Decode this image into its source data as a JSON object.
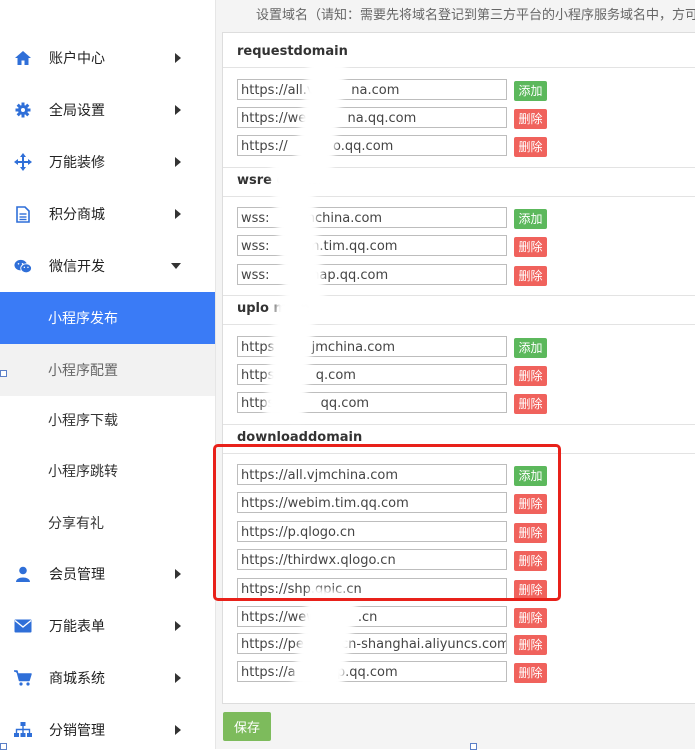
{
  "sidebar": {
    "brand": "",
    "items": [
      {
        "label": "账户中心",
        "icon": "home-icon",
        "arrow": "right"
      },
      {
        "label": "全局设置",
        "icon": "gear-icon",
        "arrow": "right"
      },
      {
        "label": "万能装修",
        "icon": "move-arrows-icon",
        "arrow": "right"
      },
      {
        "label": "积分商城",
        "icon": "document-icon",
        "arrow": "right"
      },
      {
        "label": "微信开发",
        "icon": "wechat-icon",
        "arrow": "down"
      },
      {
        "label": "会员管理",
        "icon": "user-icon",
        "arrow": "right"
      },
      {
        "label": "万能表单",
        "icon": "envelope-icon",
        "arrow": "right"
      },
      {
        "label": "商城系统",
        "icon": "cart-icon",
        "arrow": "right"
      },
      {
        "label": "分销管理",
        "icon": "sitemap-icon",
        "arrow": "right"
      }
    ],
    "subitems": [
      {
        "label": "小程序发布",
        "state": "active"
      },
      {
        "label": "小程序配置",
        "state": "hover"
      },
      {
        "label": "小程序下载",
        "state": "normal"
      },
      {
        "label": "小程序跳转",
        "state": "normal"
      },
      {
        "label": "分享有礼",
        "state": "normal"
      }
    ]
  },
  "notice": "设置域名（请知：需要先将域名登记到第三方平台的小程序服务域名中，方可进行添加",
  "sections": [
    {
      "title": "requestdomain",
      "rows": [
        {
          "value": "https://all.vj        na.com",
          "button": "添加"
        },
        {
          "value": "https://we          na.qq.com",
          "button": "删除"
        },
        {
          "value": "https://           o.qq.com",
          "button": "删除"
        }
      ]
    },
    {
      "title": "wsre        omain",
      "rows": [
        {
          "value": "wss:         nchina.com",
          "button": "添加"
        },
        {
          "value": "wss:         m.tim.qq.com",
          "button": "删除"
        },
        {
          "value": "wss:         map.qq.com",
          "button": "删除"
        }
      ]
    },
    {
      "title": "uplo        main",
      "rows": [
        {
          "value": "https         jmchina.com",
          "button": "添加"
        },
        {
          "value": "https          q.com",
          "button": "删除"
        },
        {
          "value": "https://        qq.com",
          "button": "删除"
        }
      ]
    },
    {
      "title": "downloaddomain",
      "rows": [
        {
          "value": "https://all.vjmchina.com",
          "button": "添加"
        },
        {
          "value": "https://webim.tim.qq.com",
          "button": "删除"
        },
        {
          "value": "https://p.qlogo.cn",
          "button": "删除"
        },
        {
          "value": "https://thirdwx.qlogo.cn",
          "button": "删除"
        },
        {
          "value": "https://shp.qpic.cn",
          "button": "删除"
        },
        {
          "value": "https://wewo        .cn",
          "button": "删除"
        },
        {
          "value": "https://pe         cn-shanghai.aliyuncs.com",
          "button": "删除"
        },
        {
          "value": "https://a          p.qq.com",
          "button": "删除"
        }
      ]
    }
  ],
  "save_label": "保存",
  "colors": {
    "active": "#3a7bf6",
    "add": "#5cb85c",
    "delete": "#f0625c",
    "save": "#7dbb5c",
    "highlight": "#e8211a"
  }
}
